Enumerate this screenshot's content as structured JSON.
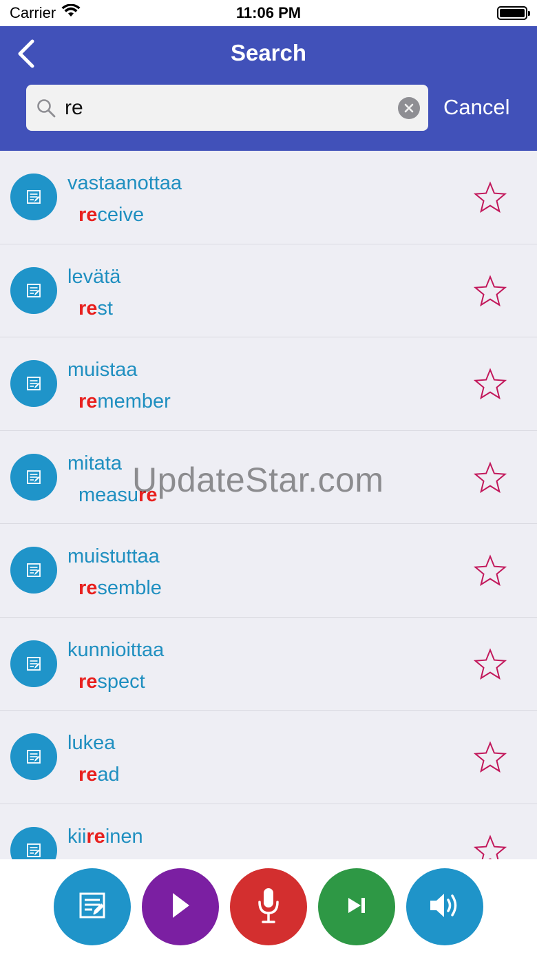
{
  "status_bar": {
    "carrier": "Carrier",
    "time": "11:06 PM",
    "wifi_icon": "wifi-icon",
    "battery_icon": "battery-icon"
  },
  "header": {
    "title": "Search",
    "back_icon": "chevron-left-icon",
    "background_color": "#4151b9"
  },
  "search": {
    "value": "re",
    "search_icon": "search-icon",
    "clear_icon": "clear-circle-icon",
    "cancel_label": "Cancel"
  },
  "results": [
    {
      "word": "vastaanottaa",
      "translation_pre": "",
      "translation_hl": "re",
      "translation_post": "ceive"
    },
    {
      "word": "levätä",
      "translation_pre": "",
      "translation_hl": "re",
      "translation_post": "st"
    },
    {
      "word": "muistaa",
      "translation_pre": "",
      "translation_hl": "re",
      "translation_post": "member"
    },
    {
      "word": "mitata",
      "translation_pre": "measu",
      "translation_hl": "re",
      "translation_post": ""
    },
    {
      "word": "muistuttaa",
      "translation_pre": "",
      "translation_hl": "re",
      "translation_post": "semble"
    },
    {
      "word": "kunnioittaa",
      "translation_pre": "",
      "translation_hl": "re",
      "translation_post": "spect"
    },
    {
      "word": "lukea",
      "translation_pre": "",
      "translation_hl": "re",
      "translation_post": "ad"
    }
  ],
  "partial_result": {
    "word_pre": "kii",
    "word_hl": "re",
    "word_post": "inen"
  },
  "watermark": "UpdateStar.com",
  "bottom_bar": {
    "buttons": [
      {
        "name": "edit-button",
        "icon": "edit-note-icon",
        "color": "#1f94c9"
      },
      {
        "name": "play-button",
        "icon": "play-icon",
        "color": "#7b1fa2"
      },
      {
        "name": "mic-button",
        "icon": "microphone-icon",
        "color": "#d32f2f"
      },
      {
        "name": "skip-next-button",
        "icon": "skip-next-icon",
        "color": "#2e9845"
      },
      {
        "name": "volume-button",
        "icon": "volume-icon",
        "color": "#1f94c9"
      }
    ]
  },
  "colors": {
    "accent_blue": "#1f8fc0",
    "highlight_red": "#e8201e",
    "star_outline": "#c2185b"
  }
}
